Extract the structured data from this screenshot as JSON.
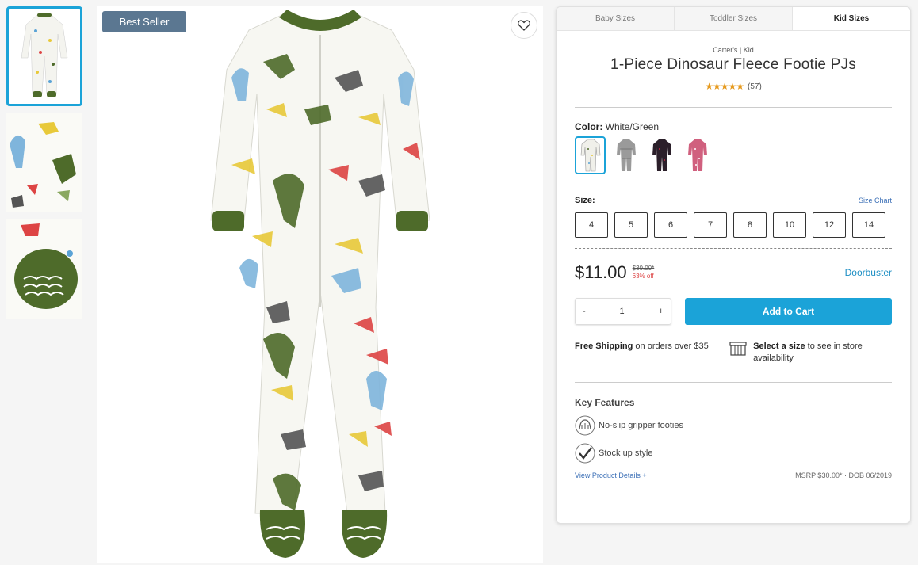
{
  "main": {
    "badge": "Best Seller"
  },
  "panel": {
    "tabs": [
      {
        "label": "Baby Sizes"
      },
      {
        "label": "Toddler Sizes"
      },
      {
        "label": "Kid Sizes"
      }
    ],
    "brand": "Carter's | Kid",
    "title": "1-Piece Dinosaur Fleece Footie PJs",
    "rating": {
      "stars": "★★★★★",
      "count": "(57)"
    },
    "color": {
      "label": "Color:",
      "value": "White/Green"
    },
    "size": {
      "label": "Size:",
      "chart_link": "Size Chart",
      "options": [
        "4",
        "5",
        "6",
        "7",
        "8",
        "10",
        "12",
        "14"
      ]
    },
    "price": {
      "current": "$11.00",
      "was": "$30.00*",
      "discount": "63% off",
      "promo": "Doorbuster"
    },
    "quantity": {
      "minus": "-",
      "value": "1",
      "plus": "+"
    },
    "add_to_cart": "Add to Cart",
    "shipping": {
      "bold": "Free Shipping",
      "rest": "on orders over $35"
    },
    "store": {
      "bold": "Select a size",
      "rest": "to see in store availability"
    },
    "features": {
      "heading": "Key Features",
      "items": [
        {
          "label": "No-slip gripper footies"
        },
        {
          "label": "Stock up style"
        }
      ]
    },
    "footer": {
      "details_link": "View Product Details",
      "plus": "+",
      "msrp": "MSRP $30.00* · DOB 06/2019"
    }
  },
  "colors": {
    "accent": "#1ba3d8",
    "badge": "#5b7791",
    "stars": "#e69a1e",
    "discount": "#dd4444",
    "pjs_trim": "#4e6b2a"
  }
}
